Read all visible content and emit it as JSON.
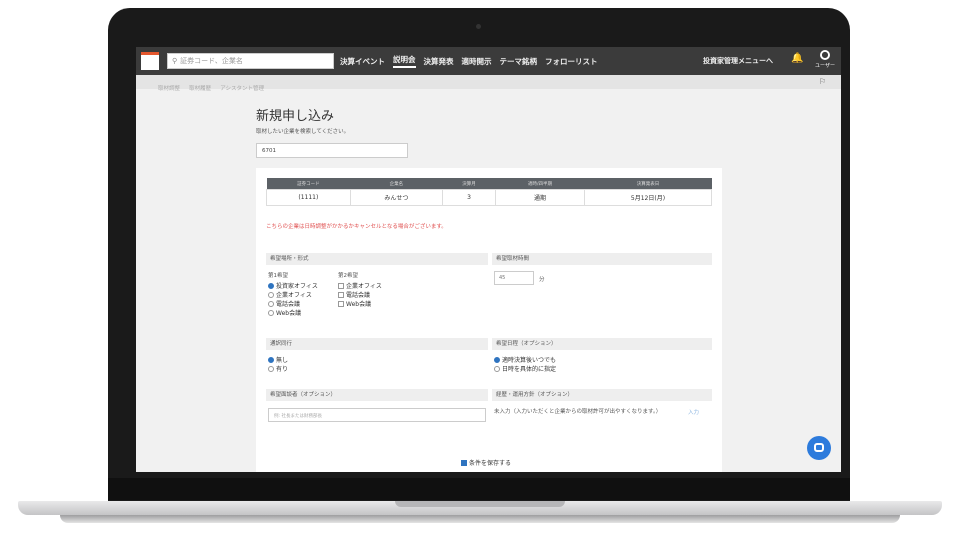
{
  "header": {
    "search_placeholder": "証券コード、企業名",
    "nav": [
      "決算イベント",
      "説明会",
      "決算発表",
      "適時開示",
      "テーマ銘柄",
      "フォローリスト"
    ],
    "active_nav": 1,
    "menu_right": "投資家管理メニューへ",
    "user_label": "ユーザー"
  },
  "subbar": {
    "links": [
      "取材調整",
      "取材履歴",
      "アシスタント管理"
    ]
  },
  "main": {
    "title": "新規申し込み",
    "subtitle": "取材したい企業を検索してください。",
    "code_value": "6701",
    "table": {
      "headers": [
        "証券コード",
        "企業名",
        "決算月",
        "適時/四半期",
        "決算発表日"
      ],
      "row": [
        "(1111)",
        "みんせつ",
        "3",
        "通期",
        "5月12日(月)"
      ]
    },
    "warning": "こちらの企業は日時調整がかかるかキャンセルとなる場合がございます。",
    "section_place": "希望場所・形式",
    "first_choice_label": "第1希望",
    "second_choice_label": "第2希望",
    "first_choices": [
      "投資家オフィス",
      "企業オフィス",
      "電話会議",
      "Web会議"
    ],
    "second_choices": [
      "企業オフィス",
      "電話会議",
      "Web会議"
    ],
    "section_time": "希望取材時間",
    "minutes_value": "45",
    "minutes_unit": "分",
    "section_interpreter": "通訳同行",
    "interpreter_options": [
      "無し",
      "有り"
    ],
    "section_date": "希望日程（オプション）",
    "date_options": [
      "適時決算後いつでも",
      "日時を具体的に指定"
    ],
    "section_attendee": "希望面談者（オプション）",
    "attendee_placeholder": "例: 社長または財務部長",
    "section_purpose": "経歴・運用方針（オプション）",
    "purpose_text": "未入力（入力いただくと企業からの取材許可が出やすくなります。）",
    "purpose_link": "入力",
    "save_label": "条件を保存する"
  },
  "colors": {
    "topbar": "#3b3b3b",
    "accent": "#2d7bdc",
    "warning": "#e05050"
  }
}
